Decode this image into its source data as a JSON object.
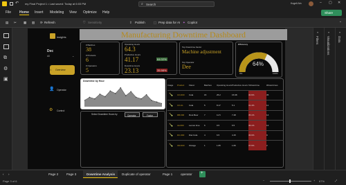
{
  "titlebar": {
    "title": "my Final Project 1 • Last saved: Today at 6:03 PM",
    "search_placeholder": "Search",
    "user": "Kogeli Ain"
  },
  "menu": {
    "items": [
      "File",
      "Home",
      "Insert",
      "Modeling",
      "View",
      "Optimize",
      "Help"
    ],
    "active": "Home",
    "share": "Share"
  },
  "toolbar": {
    "refresh": "Refresh",
    "sensitivity": "Sensitivity",
    "publish": "Publish",
    "prep_ai": "Prep data for AI",
    "copilot": "Copilot"
  },
  "report": {
    "title": "Manufacturing Downtime Dashboard",
    "logo_text": "insights",
    "month_label": "Dec",
    "month_sub": "All",
    "nav": {
      "overview": "Overview",
      "operator": "Operator",
      "control": "Control"
    },
    "kpi1": {
      "batches_label": "# Batches",
      "batches": "38",
      "products_label": "# Products",
      "products": "6",
      "operators_label": "# Operators",
      "operators": "5"
    },
    "kpi2": {
      "operating_label": "Operating Hours",
      "operating": "64.3",
      "productive_label": "Productive Hours",
      "productive": "41.17",
      "productive_pct": "64.02%",
      "downtime_label": "Downtime Hours",
      "downtime": "23.13",
      "downtime_pct": "35.98%"
    },
    "kpi3": {
      "factor_label": "Top Downtime Factor",
      "factor": "Machine adjustment",
      "operator_label": "Top Operator",
      "operator": "Dee"
    },
    "efficiency": {
      "label": "Efficiency",
      "value": "64%",
      "fraction": 0.64,
      "min": "0%",
      "max": "100%"
    },
    "hour_chart": {
      "title": "Downtime by Hour",
      "values": [
        2,
        3,
        2.5,
        4,
        3.2,
        5,
        4.2,
        6,
        3.5,
        4.8,
        3,
        2.5,
        3.8,
        2,
        1.5,
        1
      ]
    },
    "slicer": {
      "title": "Select Downtime Hours by",
      "options": [
        "Operator",
        "Factor"
      ]
    },
    "table": {
      "headers": [
        "Image",
        "Product",
        "Flavor",
        "Batches",
        "Operating Hours",
        "Productive Hours",
        "%Downtime",
        "#Downtimes"
      ],
      "rows": [
        [
          "CO-600",
          "Cola",
          "15",
          "25.2",
          "15.98",
          "30.6%",
          "35"
        ],
        [
          "CO-2L",
          "Cola",
          "5",
          "8.17",
          "5.1",
          "31.4%",
          "11"
        ],
        [
          "RB-600",
          "Root Beer",
          "7",
          "11.5",
          "7.48",
          "35.1%",
          "14"
        ],
        [
          "LE-600",
          "Lemon lime",
          "6",
          "9.5",
          "6.5",
          "36.1%",
          "12"
        ],
        [
          "DC-600",
          "Diet Cola",
          "4",
          "6.5",
          "4.15",
          "36.6%",
          "9"
        ],
        [
          "OR-600",
          "Orange",
          "1",
          "1.65",
          "1.06",
          "37.6%",
          "2"
        ]
      ]
    }
  },
  "panes": {
    "filters": "Filters",
    "visualizations": "Visualizations",
    "data": "Data"
  },
  "tabs": {
    "items": [
      "Page 2",
      "Page 3",
      "Downtime Analysis",
      "Duplicate of operator",
      "Page 1",
      "operator"
    ],
    "active": "Downtime Analysis",
    "add": "+"
  },
  "status": {
    "page": "Page 3 of 6",
    "zoom": "67%"
  },
  "colors": {
    "accent_gold": "#c9a227",
    "pill_green": "#3a6b3a",
    "pill_red": "#8b1e1e",
    "active_tab": "#2d2d2d"
  }
}
